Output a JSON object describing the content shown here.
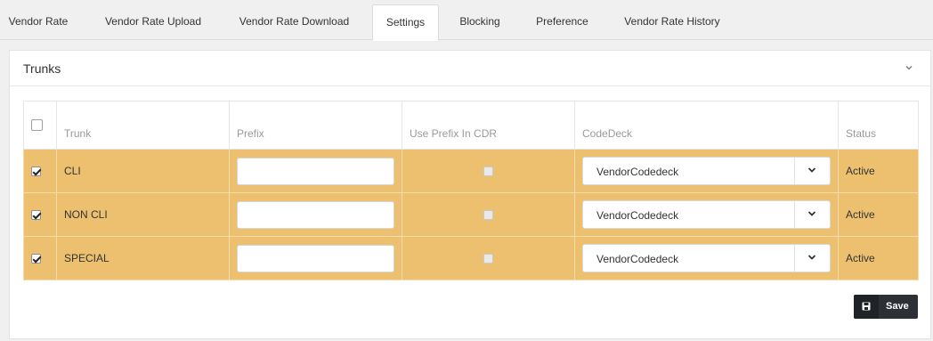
{
  "tabs": [
    {
      "label": "Vendor Rate",
      "active": false
    },
    {
      "label": "Vendor Rate Upload",
      "active": false
    },
    {
      "label": "Vendor Rate Download",
      "active": false
    },
    {
      "label": "Settings",
      "active": true
    },
    {
      "label": "Blocking",
      "active": false
    },
    {
      "label": "Preference",
      "active": false
    },
    {
      "label": "Vendor Rate History",
      "active": false
    }
  ],
  "panel": {
    "title": "Trunks",
    "collapse_icon": "chevron-down-icon"
  },
  "table": {
    "headers": {
      "trunk": "Trunk",
      "prefix": "Prefix",
      "use_prefix": "Use Prefix In CDR",
      "codedeck": "CodeDeck",
      "status": "Status"
    },
    "select_all_checked": false,
    "rows": [
      {
        "checked": true,
        "trunk": "CLI",
        "prefix": "",
        "use_prefix_in_cdr": false,
        "codedeck": "VendorCodedeck",
        "status": "Active"
      },
      {
        "checked": true,
        "trunk": "NON CLI",
        "prefix": "",
        "use_prefix_in_cdr": false,
        "codedeck": "VendorCodedeck",
        "status": "Active"
      },
      {
        "checked": true,
        "trunk": "SPECIAL",
        "prefix": "",
        "use_prefix_in_cdr": false,
        "codedeck": "VendorCodedeck",
        "status": "Active"
      }
    ]
  },
  "save_button": {
    "label": "Save",
    "icon": "floppy-disk-icon"
  },
  "colors": {
    "row_highlight": "#ecc06f",
    "button_dark": "#2d3135",
    "background": "#f0f0f0"
  }
}
